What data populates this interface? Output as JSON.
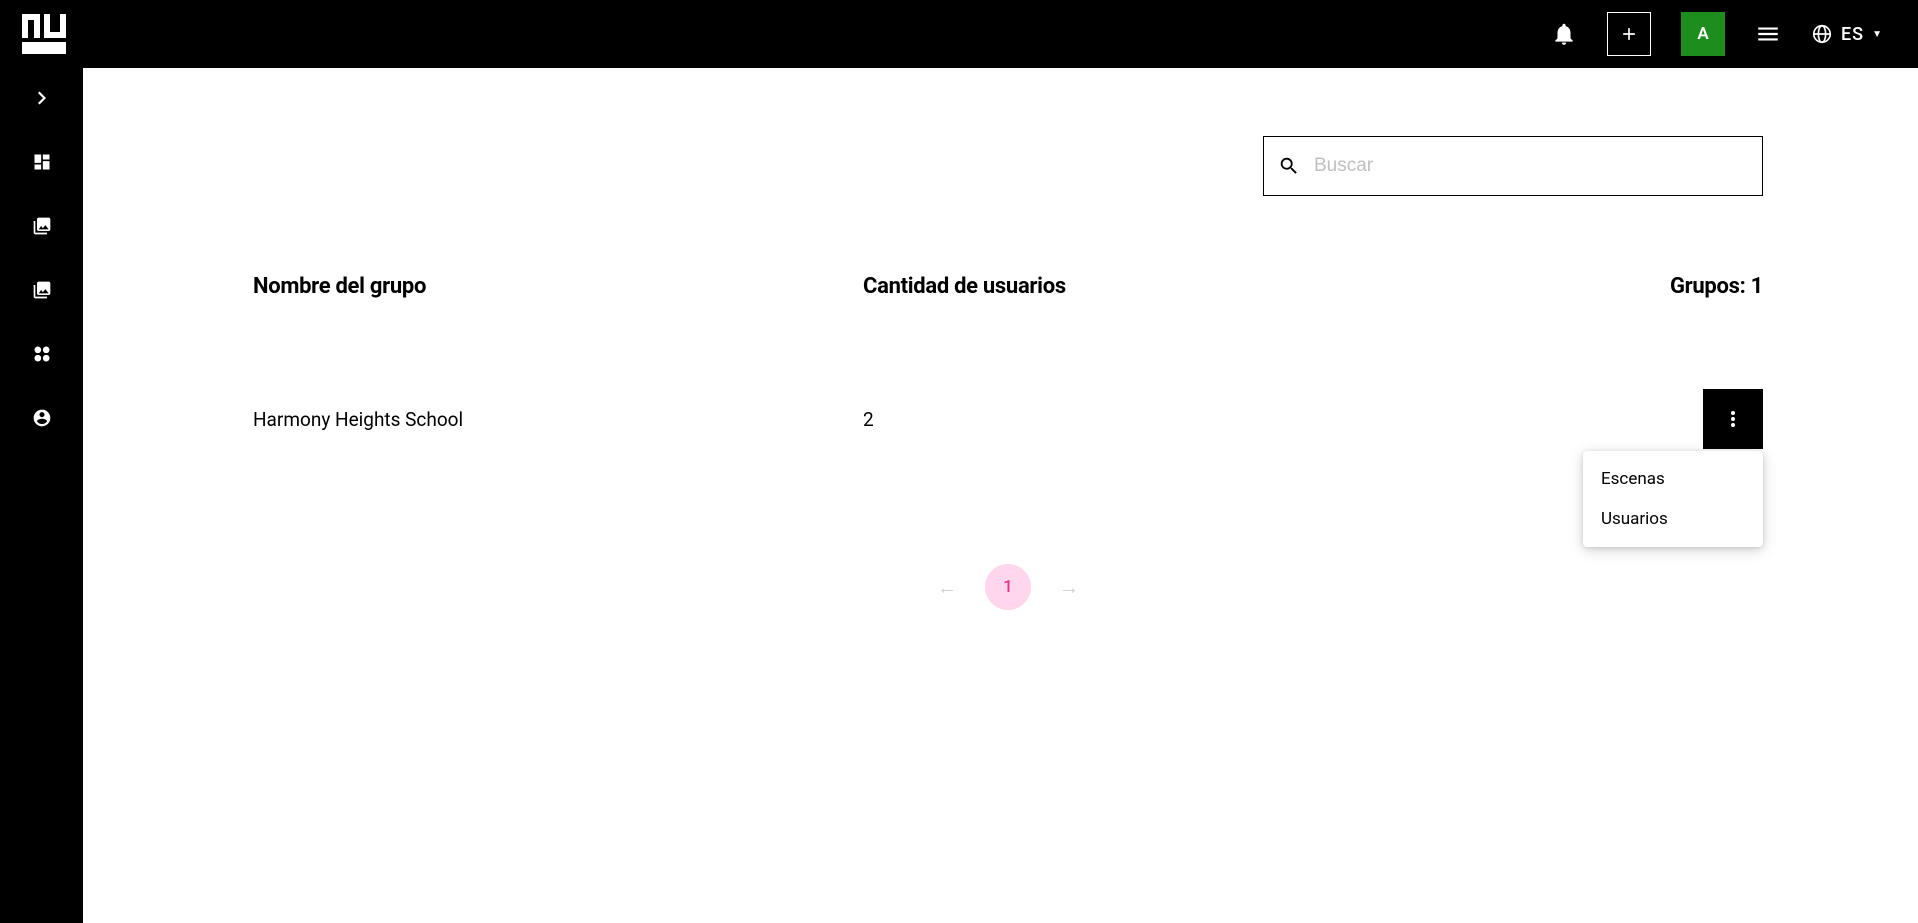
{
  "header": {
    "avatar_initial": "A",
    "lang": "ES"
  },
  "search": {
    "placeholder": "Buscar",
    "value": ""
  },
  "table": {
    "columns": {
      "name": "Nombre del grupo",
      "count": "Cantidad de usuarios"
    },
    "summary_prefix": "Grupos: ",
    "summary_count": "1",
    "rows": [
      {
        "name": "Harmony Heights School",
        "count": "2"
      }
    ]
  },
  "dropdown": {
    "items": [
      {
        "label": "Escenas"
      },
      {
        "label": "Usuarios"
      }
    ]
  },
  "pagination": {
    "current": "1"
  }
}
